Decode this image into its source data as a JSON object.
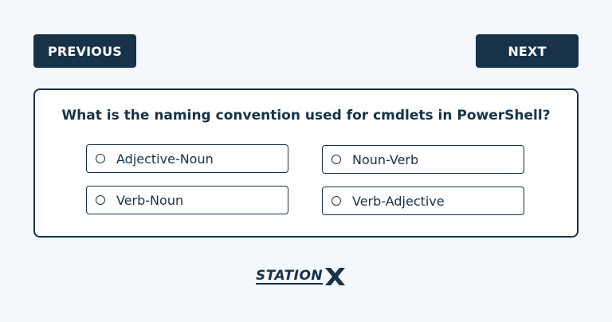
{
  "nav": {
    "previous_label": "PREVIOUS",
    "next_label": "NEXT"
  },
  "quiz": {
    "question": "What is the naming convention used for cmdlets in PowerShell?",
    "options": [
      {
        "label": "Adjective-Noun"
      },
      {
        "label": "Noun-Verb"
      },
      {
        "label": "Verb-Noun"
      },
      {
        "label": "Verb-Adjective"
      }
    ]
  },
  "brand": {
    "logo_text": "STATION",
    "logo_mark": "X",
    "color": "#173249"
  }
}
